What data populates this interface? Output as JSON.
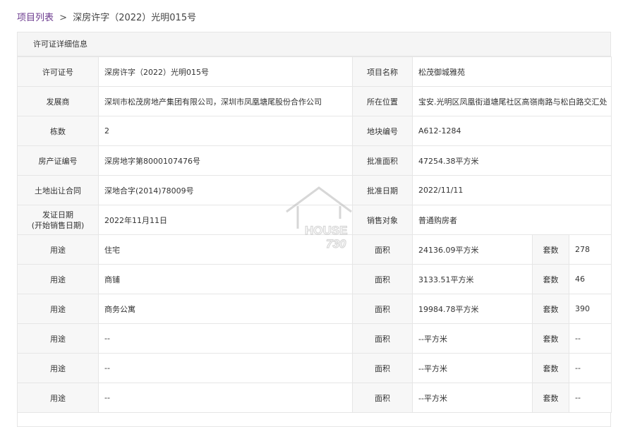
{
  "breadcrumb": {
    "link_label": "项目列表",
    "separator": ">",
    "current": "深房许字（2022）光明015号"
  },
  "panel": {
    "title": "许可证详细信息"
  },
  "info_rows": [
    {
      "label_a": "许可证号",
      "value_a": "深房许字（2022）光明015号",
      "label_b": "项目名称",
      "value_b": "松茂御城雅苑"
    },
    {
      "label_a": "发展商",
      "value_a": "深圳市松茂房地产集团有限公司，深圳市凤凰塘尾股份合作公司",
      "label_b": "所在位置",
      "value_b": "宝安.光明区凤凰街道塘尾社区高嶺南路与松白路交汇处"
    },
    {
      "label_a": "栋数",
      "value_a": "2",
      "label_b": "地块编号",
      "value_b": "A612-1284"
    },
    {
      "label_a": "房产证编号",
      "value_a": "深房地字第8000107476号",
      "label_b": "批准面积",
      "value_b": "47254.38平方米"
    },
    {
      "label_a": "土地出让合同",
      "value_a": "深地合字(2014)78009号",
      "label_b": "批准日期",
      "value_b": "2022/11/11"
    }
  ],
  "issue_row": {
    "label_line1": "发证日期",
    "label_line2": "(开始销售日期)",
    "value": "2022年11月11日",
    "label_b": "销售对象",
    "value_b": "普通购房者"
  },
  "usage_rows": [
    {
      "use_label": "用途",
      "use_value": "住宅",
      "area_label": "面积",
      "area_value": "24136.09平方米",
      "count_label": "套数",
      "count_value": "278"
    },
    {
      "use_label": "用途",
      "use_value": "商铺",
      "area_label": "面积",
      "area_value": "3133.51平方米",
      "count_label": "套数",
      "count_value": "46"
    },
    {
      "use_label": "用途",
      "use_value": "商务公寓",
      "area_label": "面积",
      "area_value": "19984.78平方米",
      "count_label": "套数",
      "count_value": "390"
    },
    {
      "use_label": "用途",
      "use_value": "--",
      "area_label": "面积",
      "area_value": "--平方米",
      "count_label": "套数",
      "count_value": "--"
    },
    {
      "use_label": "用途",
      "use_value": "--",
      "area_label": "面积",
      "area_value": "--平方米",
      "count_label": "套数",
      "count_value": "--"
    },
    {
      "use_label": "用途",
      "use_value": "--",
      "area_label": "面积",
      "area_value": "--平方米",
      "count_label": "套数",
      "count_value": "--"
    }
  ],
  "watermark": {
    "text_line1": "HOUSE",
    "text_line2": "730",
    "icon": "house-logo-icon"
  },
  "colors": {
    "link": "#6b3a8e",
    "label_bg": "#f7f7f7",
    "header_bg": "#f5f5f5",
    "border": "#e6e6e6"
  }
}
